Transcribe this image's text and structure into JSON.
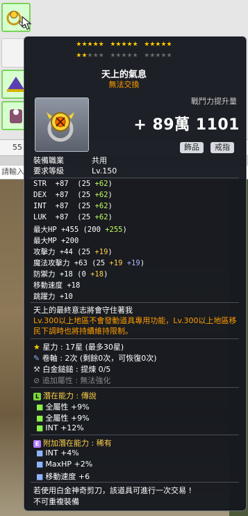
{
  "stars": {
    "row1": [
      "★★★★★",
      "★★★★★",
      "★★★★★"
    ],
    "row2": [
      "★★",
      "★★★",
      "★★★★★",
      "★★★★★"
    ]
  },
  "item": {
    "name": "天上的氣息",
    "trade": "無法交換",
    "power_label": "戰鬥力提升量",
    "power_value": "+ 89萬 1101",
    "tag1": "飾品",
    "tag2": "戒指",
    "job_label": "裝備職業",
    "job_value": "共用",
    "level_label": "要求等級",
    "level_value": "Lv.150"
  },
  "stats": [
    {
      "name": "STR",
      "base": "+87",
      "detail_a": "(25 ",
      "bonus": "+62",
      "detail_b": ")"
    },
    {
      "name": "DEX",
      "base": "+87",
      "detail_a": "(25 ",
      "bonus": "+62",
      "detail_b": ")"
    },
    {
      "name": "INT",
      "base": "+87",
      "detail_a": "(25 ",
      "bonus": "+62",
      "detail_b": ")"
    },
    {
      "name": "LUK",
      "base": "+87",
      "detail_a": "(25 ",
      "bonus": "+62",
      "detail_b": ")"
    },
    {
      "name": "最大HP",
      "base": "+455",
      "detail_a": "(200 ",
      "bonus": "+255",
      "detail_b": ")"
    },
    {
      "name": "最大MP",
      "base": "+200",
      "detail_a": "",
      "bonus": "",
      "detail_b": ""
    },
    {
      "name": "攻擊力",
      "base": "+44",
      "detail_a": "(25 ",
      "bonus": "+19",
      "detail_b": ")"
    },
    {
      "name": "魔法攻擊力",
      "base": "+63",
      "detail_a": "(25 ",
      "bonus": "+19 ",
      "bonus2": "+19",
      "detail_b": ")"
    },
    {
      "name": "防禦力",
      "base": "+18",
      "detail_a": "(0 ",
      "bonus": "+18",
      "detail_b": ")"
    },
    {
      "name": "移動速度",
      "base": "+18",
      "detail_a": "",
      "bonus": "",
      "detail_b": ""
    },
    {
      "name": "跳躍力",
      "base": "+10",
      "detail_a": "",
      "bonus": "",
      "detail_b": ""
    }
  ],
  "description": {
    "line1": "天上的最終意志將會守住著我",
    "line2": "Lv.300以上地區不會發動道具專用功能，Lv.300以上地區移民下調時也將持續維持限制。"
  },
  "info": {
    "star_force": "星力 : 17星 (最多30星)",
    "scroll": "卷軸 : 2次 (剩餘0次，可恢復0次)",
    "hammer": "白金鎚鎚 : 提煉 0/5",
    "additional": "追加屬性 : 無法強化"
  },
  "potential": {
    "header": "潛在能力 : 傳說",
    "items": [
      "全屬性 +9%",
      "全屬性 +9%",
      "INT +12%"
    ]
  },
  "bonus_potential": {
    "header": "附加潛在能力 : 稀有",
    "items": [
      "INT +4%",
      "MaxHP +2%",
      "移動速度 +6"
    ]
  },
  "footer": {
    "line1": "若使用白金神奇剪刀，該道具可進行一次交易 !",
    "line2": "不可重複裝備"
  },
  "background": {
    "count_text": "55",
    "input_placeholder": "請輸入"
  },
  "colors": {
    "star_on": "#ffcc00",
    "star_off": "#6b6b6b",
    "orange": "#ff9d00",
    "green": "#bfff5a",
    "gold": "#ffd04a",
    "blue": "#a6b7ff"
  }
}
